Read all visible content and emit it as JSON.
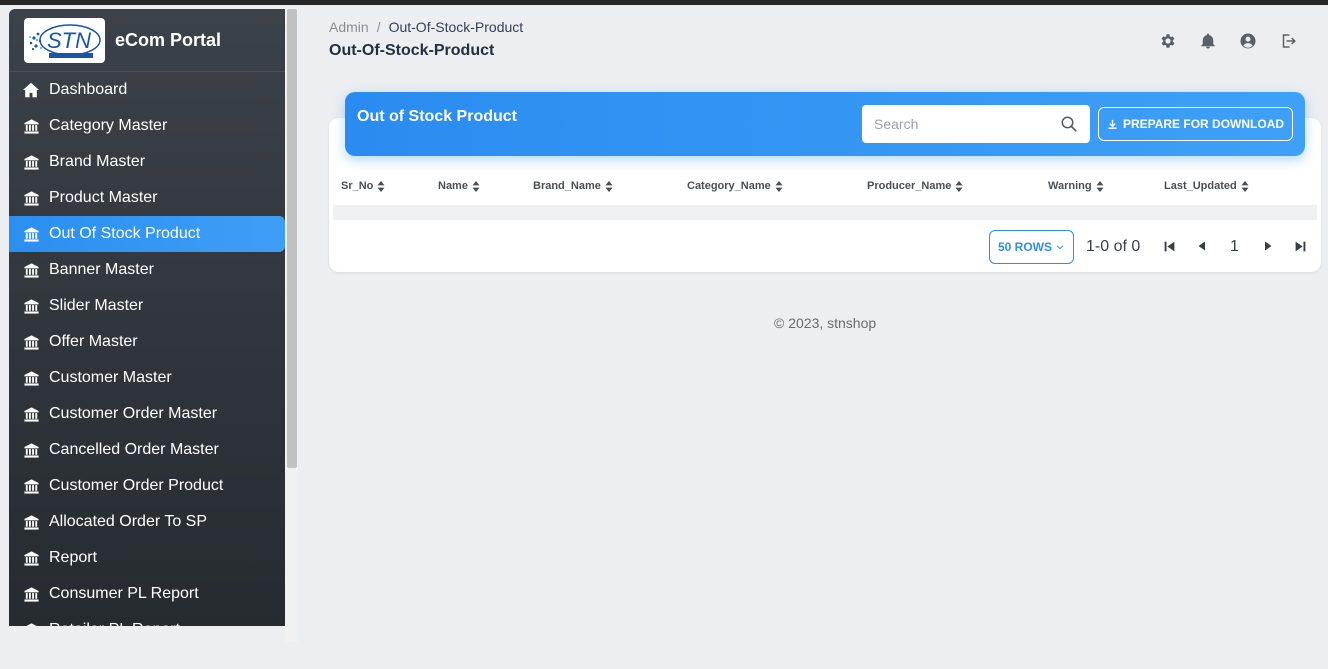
{
  "brand": {
    "logo_text": "STN",
    "name": "eCom Portal"
  },
  "sidebar": {
    "items": [
      {
        "label": "Dashboard",
        "icon": "home-icon",
        "active": false
      },
      {
        "label": "Category Master",
        "icon": "bank-icon",
        "active": false
      },
      {
        "label": "Brand Master",
        "icon": "bank-icon",
        "active": false
      },
      {
        "label": "Product Master",
        "icon": "bank-icon",
        "active": false
      },
      {
        "label": "Out Of Stock Product",
        "icon": "bank-icon",
        "active": true
      },
      {
        "label": "Banner Master",
        "icon": "bank-icon",
        "active": false
      },
      {
        "label": "Slider Master",
        "icon": "bank-icon",
        "active": false
      },
      {
        "label": "Offer Master",
        "icon": "bank-icon",
        "active": false
      },
      {
        "label": "Customer Master",
        "icon": "bank-icon",
        "active": false
      },
      {
        "label": "Customer Order Master",
        "icon": "bank-icon",
        "active": false
      },
      {
        "label": "Cancelled Order Master",
        "icon": "bank-icon",
        "active": false
      },
      {
        "label": "Customer Order Product",
        "icon": "bank-icon",
        "active": false
      },
      {
        "label": "Allocated Order To SP",
        "icon": "bank-icon",
        "active": false
      },
      {
        "label": "Report",
        "icon": "bank-icon",
        "active": false
      },
      {
        "label": "Consumer PL Report",
        "icon": "bank-icon",
        "active": false
      },
      {
        "label": "Retailer PL Report",
        "icon": "bank-icon",
        "active": false
      }
    ]
  },
  "header": {
    "breadcrumb": {
      "root": "Admin",
      "separator": "/",
      "current": "Out-Of-Stock-Product"
    },
    "title": "Out-Of-Stock-Product",
    "icons": [
      "gear-icon",
      "bell-icon",
      "account-icon",
      "logout-icon"
    ]
  },
  "card": {
    "title": "Out of Stock Product",
    "search_placeholder": "Search",
    "download_label": "PREPARE FOR DOWNLOAD",
    "columns": [
      "Sr_No",
      "Name",
      "Brand_Name",
      "Category_Name",
      "Producer_Name",
      "Warning",
      "Last_Updated"
    ],
    "rows": []
  },
  "pagination": {
    "rows_label": "50 ROWS",
    "info": "1-0 of 0",
    "page": "1"
  },
  "footer": {
    "text": "© 2023, stnshop"
  },
  "colors": {
    "accent": "#2b8ff0",
    "sidebar_bg": "#30353b",
    "page_bg": "#eceef1"
  }
}
